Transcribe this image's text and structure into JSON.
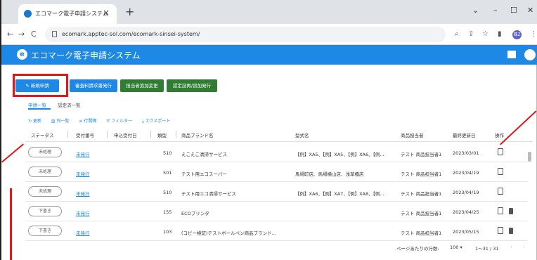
{
  "browser": {
    "tab_title": "エコマーク電子申請システム",
    "url": "ecomark.apptec-sol.com/ecomark-sinsei-system/",
    "profile_badge": "株Z"
  },
  "app": {
    "title": "エコマーク電子申請システム"
  },
  "buttons": {
    "new_application": "新規申請",
    "invoice_issue": "審査料請求書発行",
    "add_change_staff": "担当者追加変更",
    "cert_reissue": "認定証再/追加発行"
  },
  "subtabs": {
    "application_list": "申請一覧",
    "certified_list": "認定済一覧"
  },
  "toolbar": {
    "refresh": "更新",
    "columns": "列一覧",
    "row_spacing": "行間隔",
    "filter": "フィルター",
    "export": "エクスポート"
  },
  "table": {
    "headers": [
      "ステータス",
      "受付番号",
      "申込受付日",
      "類型",
      "商品ブランド名",
      "型式名",
      "商品担当者",
      "最終更新日",
      "操作"
    ],
    "rows": [
      {
        "status": "未処理",
        "receipt": "未発行",
        "date": "",
        "type": "510",
        "brand": "えこえこ清掃サービス",
        "model": "【例】XA5、【例】XA5、【例】XA6、【例...",
        "staff": "テスト 商品担当者1",
        "updated": "2023/03/01",
        "trash": false
      },
      {
        "status": "未処理",
        "receipt": "未発行",
        "date": "",
        "type": "501",
        "brand": "テスト用エコスーパー",
        "model": "馬場町店、馬場横山店、浅草橋店",
        "staff": "テスト 商品担当者1",
        "updated": "2023/04/19",
        "trash": false
      },
      {
        "status": "未処理",
        "receipt": "未発行",
        "date": "",
        "type": "510",
        "brand": "テスト用エコ清掃サービス",
        "model": "【例】XA6、【例】XA7、【例】XA8、【例...",
        "staff": "テスト 商品担当者1",
        "updated": "2023/04/19",
        "trash": false
      },
      {
        "status": "下書き",
        "receipt": "未発行",
        "date": "",
        "type": "155",
        "brand": "ECOプリンタ",
        "model": "",
        "staff": "テスト 商品担当者1",
        "updated": "2023/04/25",
        "trash": true
      },
      {
        "status": "下書き",
        "receipt": "未発行",
        "date": "",
        "type": "103",
        "brand": "(コピー検証)テストボールペン商品ブランド...",
        "model": "",
        "staff": "テスト 商品担当者1",
        "updated": "2023/05/15",
        "trash": true
      }
    ]
  },
  "pagination": {
    "rows_per_page_label": "ページあたりの行数:",
    "rows_per_page": "100",
    "range": "1〜31 / 31"
  },
  "colors": {
    "accent": "#1e88e5",
    "green": "#2e7d32",
    "highlight": "#e01818"
  }
}
